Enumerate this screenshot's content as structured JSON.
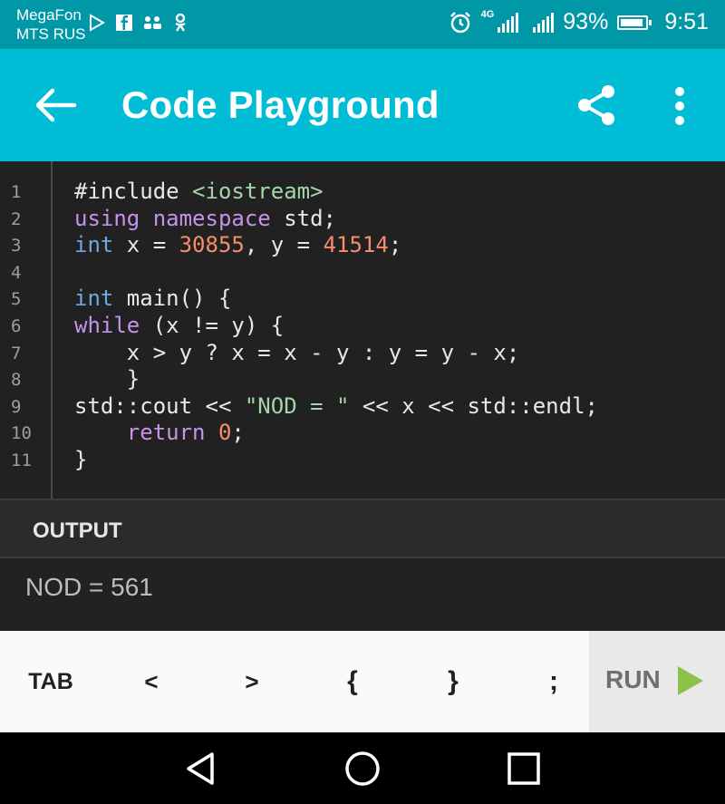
{
  "status_bar": {
    "carrier_1": "MegaFon",
    "carrier_2": "MTS RUS",
    "network": "4G",
    "battery": "93%",
    "time": "9:51",
    "battery_level": 0.93
  },
  "toolbar": {
    "title": "Code Playground"
  },
  "editor": {
    "line_numbers": [
      "1",
      "2",
      "3",
      "4",
      "5",
      "6",
      "7",
      "8",
      "9",
      "10",
      "11"
    ],
    "lines": [
      [
        {
          "t": "#include ",
          "c": "plain"
        },
        {
          "t": "<iostream>",
          "c": "str"
        }
      ],
      [
        {
          "t": "using namespace",
          "c": "kw"
        },
        {
          "t": " std;",
          "c": "plain"
        }
      ],
      [
        {
          "t": "int",
          "c": "ty"
        },
        {
          "t": " x = ",
          "c": "plain"
        },
        {
          "t": "30855",
          "c": "num"
        },
        {
          "t": ", y = ",
          "c": "plain"
        },
        {
          "t": "41514",
          "c": "num"
        },
        {
          "t": ";",
          "c": "plain"
        }
      ],
      [],
      [
        {
          "t": "int",
          "c": "ty"
        },
        {
          "t": " main() {",
          "c": "plain"
        }
      ],
      [
        {
          "t": "while",
          "c": "kw"
        },
        {
          "t": " (x != y) {",
          "c": "plain"
        }
      ],
      [
        {
          "t": "    x > y ? x = x - y : y = y - x;",
          "c": "plain"
        }
      ],
      [
        {
          "t": "    }",
          "c": "plain"
        }
      ],
      [
        {
          "t": "std::cout << ",
          "c": "plain"
        },
        {
          "t": "\"NOD = \"",
          "c": "str"
        },
        {
          "t": " << x << std::endl;",
          "c": "plain"
        }
      ],
      [
        {
          "t": "    ",
          "c": "plain"
        },
        {
          "t": "return",
          "c": "kw"
        },
        {
          "t": " ",
          "c": "plain"
        },
        {
          "t": "0",
          "c": "num"
        },
        {
          "t": ";",
          "c": "plain"
        }
      ],
      [
        {
          "t": "}",
          "c": "plain"
        }
      ]
    ]
  },
  "output": {
    "title": "OUTPUT",
    "text": "NOD = 561"
  },
  "keys": {
    "tab": "TAB",
    "lt": "<",
    "gt": ">",
    "lbrace": "{",
    "rbrace": "}",
    "semicolon": ";",
    "run": "RUN"
  },
  "icons": {
    "back": "back-arrow-icon",
    "share": "share-icon",
    "more": "more-vert-icon",
    "run": "play-icon",
    "nav_back": "nav-back-icon",
    "nav_home": "nav-home-icon",
    "nav_recents": "nav-recents-icon"
  },
  "colors": {
    "status_bar": "#0097a7",
    "toolbar": "#00bcd4",
    "editor_bg": "#212121",
    "run_icon": "#8bc34a"
  }
}
